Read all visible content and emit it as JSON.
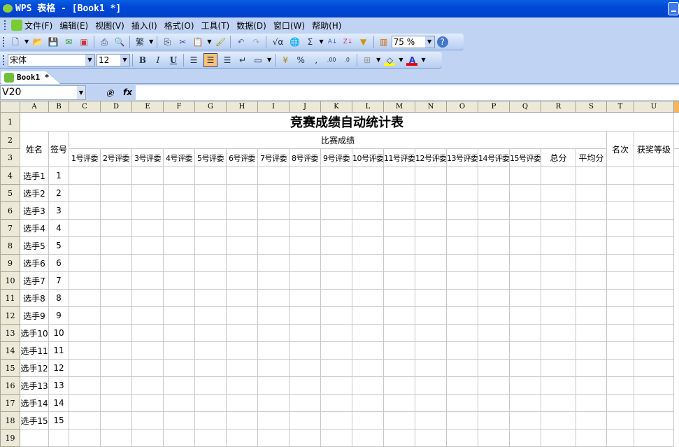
{
  "window": {
    "title": "WPS 表格 - [Book1 *]"
  },
  "menu": [
    "文件(F)",
    "编辑(E)",
    "视图(V)",
    "插入(I)",
    "格式(O)",
    "工具(T)",
    "数据(D)",
    "窗口(W)",
    "帮助(H)"
  ],
  "toolbar": {
    "zoom": "75 %",
    "font": "宋体",
    "size": "12",
    "traditional": "繁"
  },
  "tab": {
    "label": "Book1 *"
  },
  "formula": {
    "cell_ref": "V20",
    "value": ""
  },
  "sheet": {
    "columns": [
      "A",
      "B",
      "C",
      "D",
      "E",
      "F",
      "G",
      "H",
      "I",
      "J",
      "K",
      "L",
      "M",
      "N",
      "O",
      "P",
      "Q",
      "R",
      "S",
      "T",
      "U",
      ""
    ],
    "selected_column": "V",
    "title": "竞赛成绩自动统计表",
    "group_header": "比赛成绩",
    "name_header": "姓名",
    "num_header": "签号",
    "rank_header": "名次",
    "award_header": "获奖等级",
    "judges": [
      "1号评委",
      "2号评委",
      "3号评委",
      "4号评委",
      "5号评委",
      "6号评委",
      "7号评委",
      "8号评委",
      "9号评委",
      "10号评委",
      "11号评委",
      "12号评委",
      "13号评委",
      "14号评委",
      "15号评委"
    ],
    "total_header": "总分",
    "avg_header": "平均分",
    "players": [
      {
        "row": 4,
        "name": "选手1",
        "num": "1"
      },
      {
        "row": 5,
        "name": "选手2",
        "num": "2"
      },
      {
        "row": 6,
        "name": "选手3",
        "num": "3"
      },
      {
        "row": 7,
        "name": "选手4",
        "num": "4"
      },
      {
        "row": 8,
        "name": "选手5",
        "num": "5"
      },
      {
        "row": 9,
        "name": "选手6",
        "num": "6"
      },
      {
        "row": 10,
        "name": "选手7",
        "num": "7"
      },
      {
        "row": 11,
        "name": "选手8",
        "num": "8"
      },
      {
        "row": 12,
        "name": "选手9",
        "num": "9"
      },
      {
        "row": 13,
        "name": "选手10",
        "num": "10"
      },
      {
        "row": 14,
        "name": "选手11",
        "num": "11"
      },
      {
        "row": 15,
        "name": "选手12",
        "num": "12"
      },
      {
        "row": 16,
        "name": "选手13",
        "num": "13"
      },
      {
        "row": 17,
        "name": "选手14",
        "num": "14"
      },
      {
        "row": 18,
        "name": "选手15",
        "num": "15"
      },
      {
        "row": 19,
        "name": "",
        "num": ""
      }
    ]
  }
}
